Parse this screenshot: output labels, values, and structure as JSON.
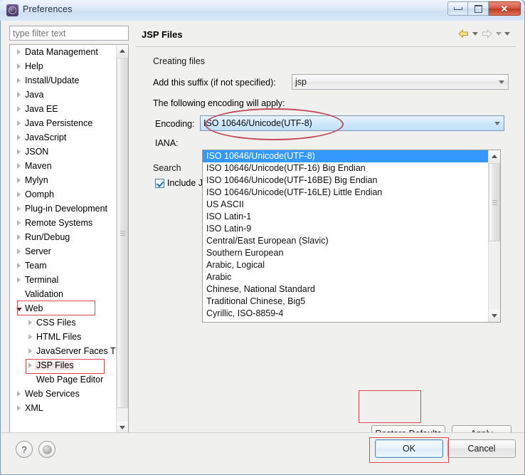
{
  "window": {
    "title": "Preferences",
    "icon": "eclipse-gear-icon",
    "buttons": {
      "minimize": "minimize-icon",
      "maximize": "restore-icon",
      "close": "✕"
    }
  },
  "sidebar": {
    "filter_placeholder": "type filter text",
    "filter_value": "",
    "items": [
      {
        "label": "Data Management",
        "indent": 0,
        "expandable": true,
        "expanded": false,
        "selected": false
      },
      {
        "label": "Help",
        "indent": 0,
        "expandable": true,
        "expanded": false,
        "selected": false
      },
      {
        "label": "Install/Update",
        "indent": 0,
        "expandable": true,
        "expanded": false,
        "selected": false
      },
      {
        "label": "Java",
        "indent": 0,
        "expandable": true,
        "expanded": false,
        "selected": false
      },
      {
        "label": "Java EE",
        "indent": 0,
        "expandable": true,
        "expanded": false,
        "selected": false
      },
      {
        "label": "Java Persistence",
        "indent": 0,
        "expandable": true,
        "expanded": false,
        "selected": false
      },
      {
        "label": "JavaScript",
        "indent": 0,
        "expandable": true,
        "expanded": false,
        "selected": false
      },
      {
        "label": "JSON",
        "indent": 0,
        "expandable": true,
        "expanded": false,
        "selected": false
      },
      {
        "label": "Maven",
        "indent": 0,
        "expandable": true,
        "expanded": false,
        "selected": false
      },
      {
        "label": "Mylyn",
        "indent": 0,
        "expandable": true,
        "expanded": false,
        "selected": false
      },
      {
        "label": "Oomph",
        "indent": 0,
        "expandable": true,
        "expanded": false,
        "selected": false
      },
      {
        "label": "Plug-in Development",
        "indent": 0,
        "expandable": true,
        "expanded": false,
        "selected": false
      },
      {
        "label": "Remote Systems",
        "indent": 0,
        "expandable": true,
        "expanded": false,
        "selected": false
      },
      {
        "label": "Run/Debug",
        "indent": 0,
        "expandable": true,
        "expanded": false,
        "selected": false
      },
      {
        "label": "Server",
        "indent": 0,
        "expandable": true,
        "expanded": false,
        "selected": false
      },
      {
        "label": "Team",
        "indent": 0,
        "expandable": true,
        "expanded": false,
        "selected": false
      },
      {
        "label": "Terminal",
        "indent": 0,
        "expandable": true,
        "expanded": false,
        "selected": false
      },
      {
        "label": "Validation",
        "indent": 0,
        "expandable": false,
        "expanded": false,
        "selected": false
      },
      {
        "label": "Web",
        "indent": 0,
        "expandable": true,
        "expanded": true,
        "selected": false,
        "highlight": true
      },
      {
        "label": "CSS Files",
        "indent": 1,
        "expandable": true,
        "expanded": false,
        "selected": false
      },
      {
        "label": "HTML Files",
        "indent": 1,
        "expandable": true,
        "expanded": false,
        "selected": false
      },
      {
        "label": "JavaServer Faces T",
        "indent": 1,
        "expandable": true,
        "expanded": false,
        "selected": false
      },
      {
        "label": "JSP Files",
        "indent": 1,
        "expandable": true,
        "expanded": false,
        "selected": true,
        "highlight": true
      },
      {
        "label": "Web Page Editor",
        "indent": 1,
        "expandable": false,
        "expanded": false,
        "selected": false
      },
      {
        "label": "Web Services",
        "indent": 0,
        "expandable": true,
        "expanded": false,
        "selected": false
      },
      {
        "label": "XML",
        "indent": 0,
        "expandable": true,
        "expanded": false,
        "selected": false
      }
    ]
  },
  "main": {
    "title": "JSP Files",
    "nav": {
      "back": "back-arrow-icon",
      "forward": "forward-arrow-icon"
    },
    "creating_files": {
      "group_label": "Creating files",
      "suffix_label": "Add this suffix (if not specified):",
      "suffix_value": "jsp",
      "encoding_note": "The following encoding will apply:",
      "encoding_label": "Encoding:",
      "encoding_value": "ISO 10646/Unicode(UTF-8)",
      "iana_label": "IANA:",
      "iana_value": ""
    },
    "encoding_options": [
      "ISO 10646/Unicode(UTF-8)",
      "ISO 10646/Unicode(UTF-16) Big Endian",
      "ISO 10646/Unicode(UTF-16BE) Big Endian",
      "ISO 10646/Unicode(UTF-16LE) Little Endian",
      "US ASCII",
      "ISO Latin-1",
      "ISO Latin-9",
      "Central/East European (Slavic)",
      "Southern European",
      "Arabic, Logical",
      "Arabic",
      "Chinese, National Standard",
      "Traditional Chinese, Big5",
      "Cyrillic, ISO-8859-4"
    ],
    "search": {
      "group_label": "Search",
      "checkbox_label": "Include J",
      "checkbox_checked": true
    },
    "buttons": {
      "restore_defaults": "Restore Defaults",
      "apply": "Apply"
    }
  },
  "footer": {
    "help": "?",
    "secondary": "settings-dot-icon",
    "ok": "OK",
    "cancel": "Cancel"
  },
  "colors": {
    "selection_blue": "#3399ff",
    "annotation_red": "#e0484f",
    "close_red": "#bc3a20",
    "focus_blue": "#4f8fbf"
  }
}
